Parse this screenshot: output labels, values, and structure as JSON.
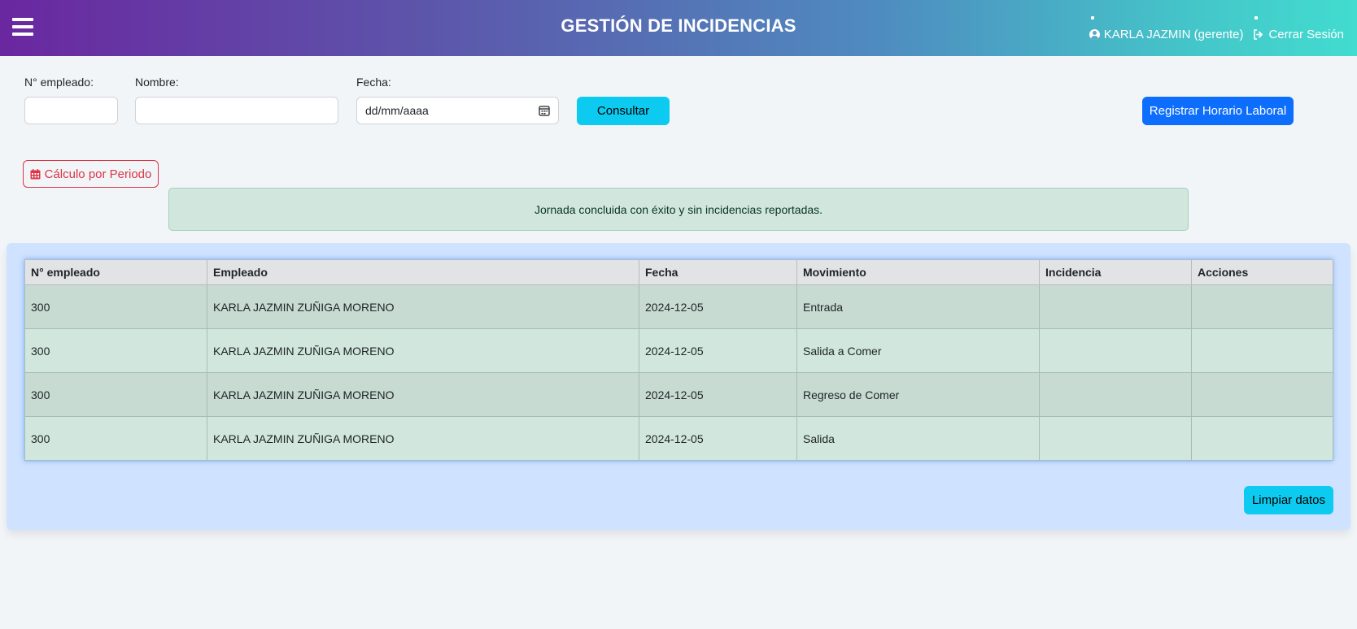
{
  "header": {
    "title": "GESTIÓN DE INCIDENCIAS",
    "user_label": "KARLA JAZMIN (gerente)",
    "logout_label": "Cerrar Sesión"
  },
  "filters": {
    "employee_no_label": "N° empleado:",
    "employee_no_value": "",
    "name_label": "Nombre:",
    "name_value": "",
    "date_label": "Fecha:",
    "date_placeholder": "dd/mm/aaaa",
    "consult_button": "Consultar",
    "register_button": "Registrar Horario Laboral"
  },
  "period_button": "Cálculo por Periodo",
  "alert_message": "Jornada concluida con éxito y sin incidencias reportadas.",
  "table": {
    "headers": [
      "N° empleado",
      "Empleado",
      "Fecha",
      "Movimiento",
      "Incidencia",
      "Acciones"
    ],
    "rows": [
      {
        "no": "300",
        "employee": "KARLA JAZMIN ZUÑIGA MORENO",
        "date": "2024-12-05",
        "movement": "Entrada",
        "incident": "",
        "actions": ""
      },
      {
        "no": "300",
        "employee": "KARLA JAZMIN ZUÑIGA MORENO",
        "date": "2024-12-05",
        "movement": "Salida a Comer",
        "incident": "",
        "actions": ""
      },
      {
        "no": "300",
        "employee": "KARLA JAZMIN ZUÑIGA MORENO",
        "date": "2024-12-05",
        "movement": "Regreso de Comer",
        "incident": "",
        "actions": ""
      },
      {
        "no": "300",
        "employee": "KARLA JAZMIN ZUÑIGA MORENO",
        "date": "2024-12-05",
        "movement": "Salida",
        "incident": "",
        "actions": ""
      }
    ]
  },
  "clear_button": "Limpiar datos",
  "colors": {
    "primary": "#0d6efd",
    "info": "#0dcaf0",
    "danger": "#dc3545",
    "success_bg": "#d1e7dd",
    "panel_bg": "#cfe2ff"
  },
  "icons": [
    "menu-icon",
    "user-circle-icon",
    "logout-icon",
    "calendar-icon"
  ]
}
